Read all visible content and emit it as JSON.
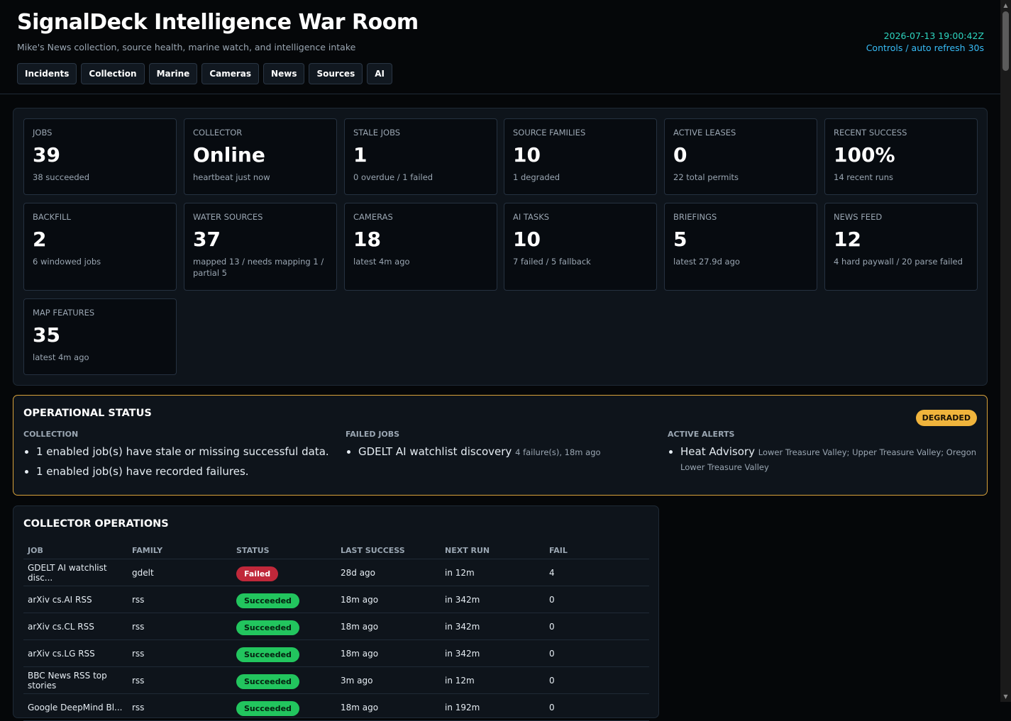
{
  "header": {
    "title": "SignalDeck Intelligence War Room",
    "subtitle": "Mike's News collection, source health, marine watch, and intelligence intake",
    "timestamp": "2026-07-13 19:00:42Z",
    "controls": "Controls / auto refresh 30s"
  },
  "nav": [
    "Incidents",
    "Collection",
    "Marine",
    "Cameras",
    "News",
    "Sources",
    "AI"
  ],
  "metrics": [
    {
      "label": "JOBS",
      "value": "39",
      "sub": "38 succeeded"
    },
    {
      "label": "COLLECTOR",
      "value": "Online",
      "sub": "heartbeat just now"
    },
    {
      "label": "STALE JOBS",
      "value": "1",
      "sub": "0 overdue / 1 failed"
    },
    {
      "label": "SOURCE FAMILIES",
      "value": "10",
      "sub": "1 degraded"
    },
    {
      "label": "ACTIVE LEASES",
      "value": "0",
      "sub": "22 total permits"
    },
    {
      "label": "RECENT SUCCESS",
      "value": "100%",
      "sub": "14 recent runs"
    },
    {
      "label": "BACKFILL",
      "value": "2",
      "sub": "6 windowed jobs"
    },
    {
      "label": "WATER SOURCES",
      "value": "37",
      "sub": "mapped 13 / needs mapping 1 / partial 5"
    },
    {
      "label": "CAMERAS",
      "value": "18",
      "sub": "latest 4m ago"
    },
    {
      "label": "AI TASKS",
      "value": "10",
      "sub": "7 failed / 5 fallback"
    },
    {
      "label": "BRIEFINGS",
      "value": "5",
      "sub": "latest 27.9d ago"
    },
    {
      "label": "NEWS FEED",
      "value": "12",
      "sub": "4 hard paywall / 20 parse failed"
    },
    {
      "label": "MAP FEATURES",
      "value": "35",
      "sub": "latest 4m ago"
    }
  ],
  "ops_status": {
    "title": "OPERATIONAL STATUS",
    "badge": "DEGRADED",
    "collection": {
      "title": "COLLECTION",
      "items": [
        "1 enabled job(s) have stale or missing successful data.",
        "1 enabled job(s) have recorded failures."
      ]
    },
    "failed_jobs": {
      "title": "FAILED JOBS",
      "items": [
        {
          "name": "GDELT AI watchlist discovery",
          "detail": "4 failure(s), 18m ago"
        }
      ]
    },
    "active_alerts": {
      "title": "ACTIVE ALERTS",
      "items": [
        {
          "name": "Heat Advisory",
          "detail": "Lower Treasure Valley; Upper Treasure Valley; Oregon Lower Treasure Valley"
        }
      ]
    }
  },
  "collector_ops": {
    "title": "COLLECTOR OPERATIONS",
    "columns": [
      "JOB",
      "FAMILY",
      "STATUS",
      "LAST SUCCESS",
      "NEXT RUN",
      "FAIL"
    ],
    "rows": [
      {
        "job": "GDELT AI watchlist disc...",
        "family": "gdelt",
        "status": "Failed",
        "last": "28d ago",
        "next": "in 12m",
        "fail": "4"
      },
      {
        "job": "arXiv cs.AI RSS",
        "family": "rss",
        "status": "Succeeded",
        "last": "18m ago",
        "next": "in 342m",
        "fail": "0"
      },
      {
        "job": "arXiv cs.CL RSS",
        "family": "rss",
        "status": "Succeeded",
        "last": "18m ago",
        "next": "in 342m",
        "fail": "0"
      },
      {
        "job": "arXiv cs.LG RSS",
        "family": "rss",
        "status": "Succeeded",
        "last": "18m ago",
        "next": "in 342m",
        "fail": "0"
      },
      {
        "job": "BBC News RSS top stories",
        "family": "rss",
        "status": "Succeeded",
        "last": "3m ago",
        "next": "in 12m",
        "fail": "0"
      },
      {
        "job": "Google DeepMind Bl...",
        "family": "rss",
        "status": "Succeeded",
        "last": "18m ago",
        "next": "in 192m",
        "fail": "0"
      }
    ]
  },
  "colors": {
    "background": "#050709",
    "panel": "#0e141b",
    "accent_time": "#2dd4bf",
    "accent_controls": "#38bdf8",
    "degraded": "#f0b43c",
    "failed": "#c0283a",
    "succeeded": "#22c55e"
  }
}
